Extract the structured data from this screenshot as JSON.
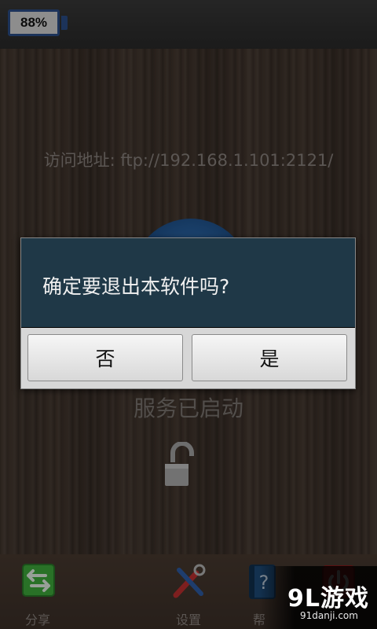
{
  "status_bar": {
    "battery_percent": "88%"
  },
  "main": {
    "address_label": "访问地址: ftp://192.168.1.101:2121/",
    "service_status": "服务已启动",
    "lock_icon": "unlock-icon"
  },
  "dialog": {
    "message": "确定要退出本软件吗?",
    "no_label": "否",
    "yes_label": "是"
  },
  "bottom_bar": {
    "tabs": [
      {
        "label": "分享",
        "icon": "share-icon"
      },
      {
        "label": "设置",
        "icon": "settings-tools-icon"
      },
      {
        "label": "帮",
        "icon": "help-book-icon"
      },
      {
        "label": "",
        "icon": "power-icon"
      }
    ]
  },
  "watermark": {
    "brand": "9L游戏",
    "url": "91danji.com"
  },
  "colors": {
    "dialog_title_bg": "#1f3847",
    "battery_border": "#2b4f8a",
    "share_green": "#3fae3c",
    "power_red": "#d22a2a"
  }
}
